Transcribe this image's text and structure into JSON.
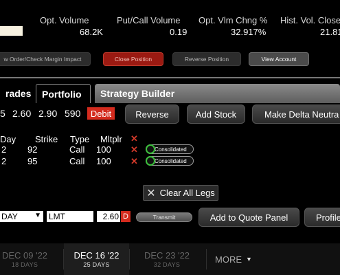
{
  "stats": {
    "opt_volume_label": "Opt. Volume",
    "opt_volume_value": "68.2K",
    "put_call_label": "Put/Call Volume",
    "put_call_value": "0.19",
    "opt_vlm_chng_label": "Opt. Vlm Chng %",
    "opt_vlm_chng_value": "32.917%",
    "hist_vol_label": "Hist. Vol. Close",
    "hist_vol_value": "21.81"
  },
  "action_buttons": {
    "preview": "w Order/Check Margin Impact",
    "close_position": "Close Position",
    "reverse_position": "Reverse Position",
    "view_account": "View Account"
  },
  "tabs": {
    "trades": "rades",
    "portfolio": "Portfolio",
    "strategy_builder": "Strategy Builder"
  },
  "quote": {
    "q1": "5",
    "q2": "2.60",
    "q3": "2.90",
    "q4": "590",
    "debit": "Debit",
    "reverse": "Reverse",
    "add_stock": "Add Stock",
    "make_delta_neutral": "Make Delta Neutra"
  },
  "legs": {
    "headers": {
      "day": "Day",
      "strike": "Strike",
      "type": "Type",
      "mltplr": "Mltplr"
    },
    "rows": [
      {
        "day": "2",
        "strike": "92",
        "type": "Call",
        "mltplr": "100",
        "status": "Consolidated"
      },
      {
        "day": "2",
        "strike": "95",
        "type": "Call",
        "mltplr": "100",
        "status": "Consolidated"
      }
    ]
  },
  "clear_all_legs": "Clear All Legs",
  "order": {
    "tif": "DAY",
    "type": "LMT",
    "price": "2.60",
    "price_flag": "D",
    "transmit": "Transmit",
    "add_to_quote_panel": "Add to Quote Panel",
    "profile": "Profile"
  },
  "expiries": [
    {
      "date": "DEC 09 '22",
      "days": "18 DAYS"
    },
    {
      "date": "DEC 16 '22",
      "days": "25 DAYS"
    },
    {
      "date": "DEC 23 '22",
      "days": "32 DAYS"
    }
  ],
  "more_label": "MORE",
  "colors": {
    "debit_red": "#d42b1e",
    "consolidated_ring": "#3cc13c",
    "close_position_red": "#9b1a12"
  }
}
